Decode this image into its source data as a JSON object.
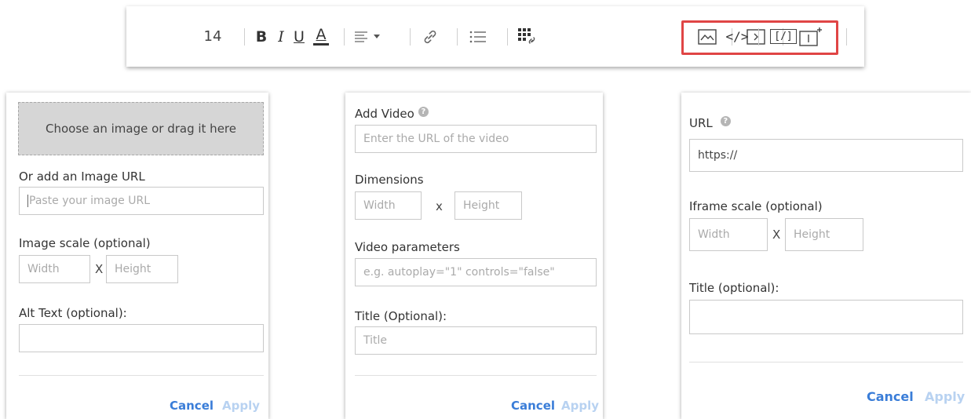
{
  "toolbar": {
    "font_size": "14",
    "bold": "B",
    "italic": "I",
    "underline": "U",
    "text_color": "A",
    "code": "</>",
    "code_block": "[/]",
    "highlight_color": "#e04545"
  },
  "image_panel": {
    "dropzone_text": "Choose an image or drag it here",
    "url_label": "Or add an Image URL",
    "url_placeholder": "Paste your image URL",
    "scale_label": "Image scale (optional)",
    "width_placeholder": "Width",
    "x": "X",
    "height_placeholder": "Height",
    "alt_label": "Alt Text (optional):",
    "cancel": "Cancel",
    "apply": "Apply"
  },
  "video_panel": {
    "add_label": "Add Video",
    "url_placeholder": "Enter the URL of the video",
    "dimensions_label": "Dimensions",
    "width_placeholder": "Width",
    "x": "x",
    "height_placeholder": "Height",
    "params_label": "Video parameters",
    "params_placeholder": "e.g. autoplay=\"1\" controls=\"false\"",
    "title_label": "Title (Optional):",
    "title_placeholder": "Title",
    "cancel": "Cancel",
    "apply": "Apply"
  },
  "iframe_panel": {
    "url_label": "URL",
    "url_value": "https://",
    "scale_label": "Iframe scale (optional)",
    "width_placeholder": "Width",
    "x": "X",
    "height_placeholder": "Height",
    "title_label": "Title (optional):",
    "cancel": "Cancel",
    "apply": "Apply"
  }
}
